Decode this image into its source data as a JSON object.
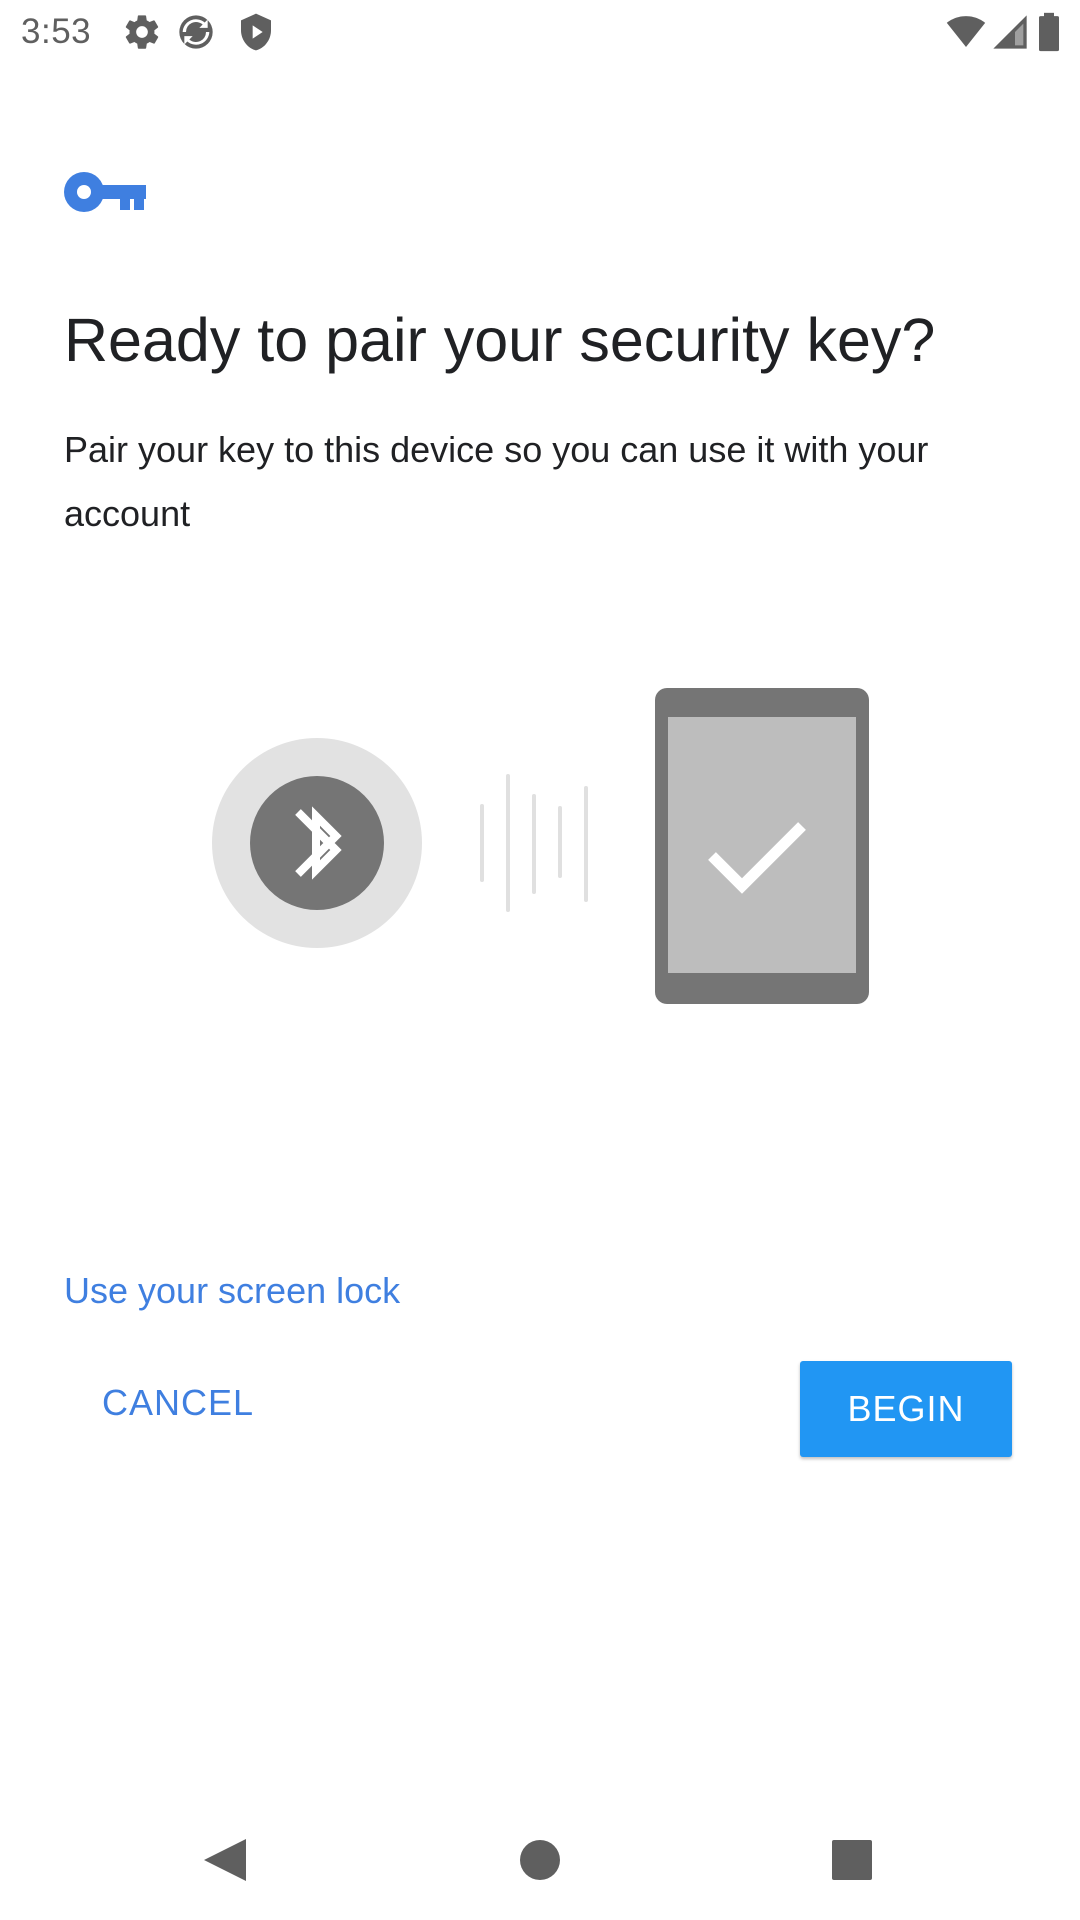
{
  "status_bar": {
    "time": "3:53",
    "icons": [
      "settings-icon",
      "sync-icon",
      "shield-play-icon",
      "wifi-icon",
      "cell-signal-icon",
      "battery-icon"
    ],
    "icon_color": "#5f5f5f"
  },
  "content": {
    "header_icon": "key-icon",
    "title": "Ready to pair your security key?",
    "subtitle": "Pair your key to this device so you can use it with your account",
    "illustration": {
      "left_icon": "bluetooth-icon",
      "right_icon": "phone-check-icon"
    },
    "screen_lock_link": "Use your screen lock"
  },
  "actions": {
    "cancel_label": "CANCEL",
    "begin_label": "BEGIN"
  },
  "nav_bar": {
    "back": "back-icon",
    "home": "home-icon",
    "recents": "recents-icon"
  },
  "colors": {
    "accent": "#3f7fe0",
    "primary_button": "#2196f3",
    "text": "#202124"
  }
}
